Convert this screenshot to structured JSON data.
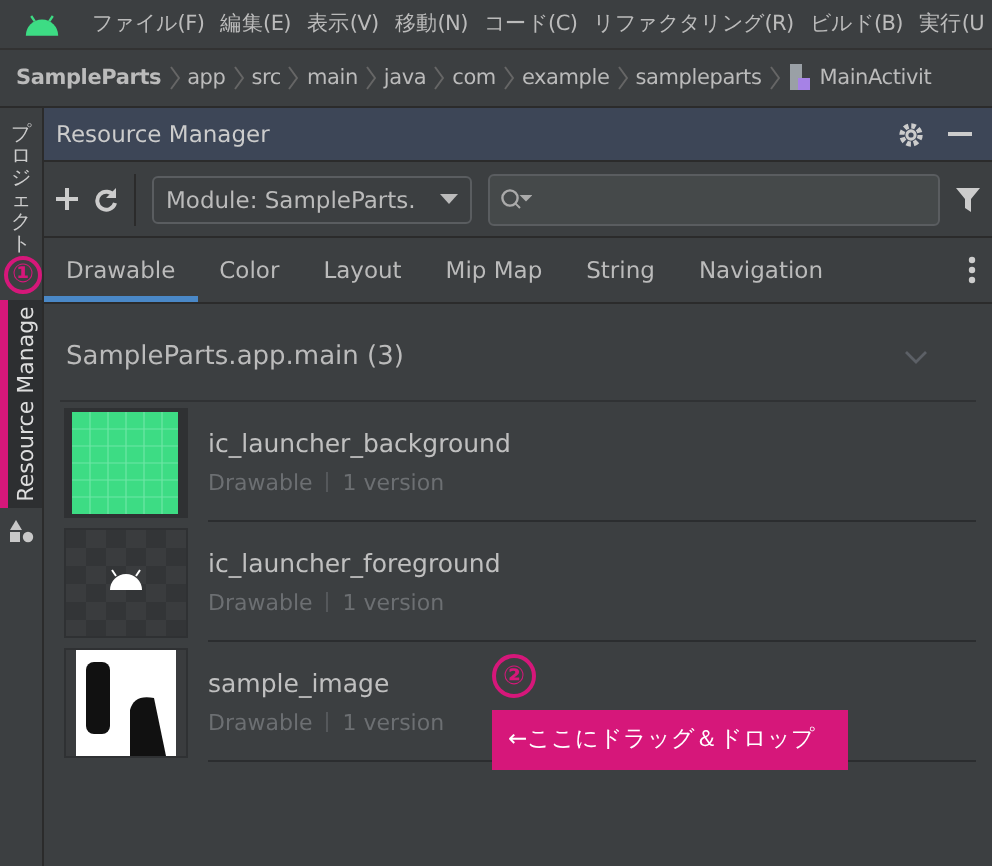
{
  "menu_bar": {
    "items": [
      "ファイル(F)",
      "編集(E)",
      "表示(V)",
      "移動(N)",
      "コード(C)",
      "リファクタリング(R)",
      "ビルド(B)",
      "実行(U"
    ]
  },
  "breadcrumb": {
    "items": [
      "SampleParts",
      "app",
      "src",
      "main",
      "java",
      "com",
      "example",
      "sampleparts"
    ],
    "file": "MainActivit"
  },
  "left_strip": {
    "tabs": [
      {
        "label": "プロジェクト",
        "selected": false
      },
      {
        "label": "Resource Manage",
        "selected": true
      }
    ]
  },
  "panel": {
    "title": "Resource Manager",
    "module_dropdown": "Module: SampleParts.",
    "tabs": [
      {
        "label": "Drawable",
        "selected": true
      },
      {
        "label": "Color",
        "selected": false
      },
      {
        "label": "Layout",
        "selected": false
      },
      {
        "label": "Mip Map",
        "selected": false
      },
      {
        "label": "String",
        "selected": false
      },
      {
        "label": "Navigation",
        "selected": false
      }
    ],
    "group": {
      "title": "SampleParts.app.main (3)",
      "expanded": true
    },
    "resources": [
      {
        "name": "ic_launcher_background",
        "type": "Drawable",
        "versions": "1 version",
        "kind": "grid"
      },
      {
        "name": "ic_launcher_foreground",
        "type": "Drawable",
        "versions": "1 version",
        "kind": "android"
      },
      {
        "name": "sample_image",
        "type": "Drawable",
        "versions": "1 version",
        "kind": "picture"
      }
    ]
  },
  "annotations": [
    {
      "marker": "①"
    },
    {
      "marker": "②",
      "label": "←ここにドラッグ＆ドロップ"
    }
  ]
}
